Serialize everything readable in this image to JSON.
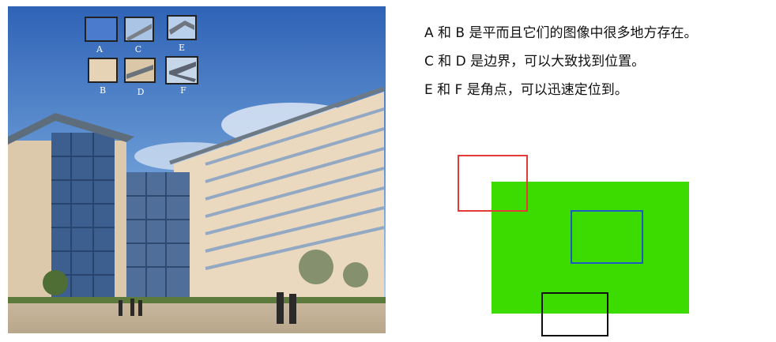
{
  "photo": {
    "patches": [
      {
        "label": "A",
        "icon": "flat-blue-sky-patch"
      },
      {
        "label": "C",
        "icon": "roof-edge-patch"
      },
      {
        "label": "E",
        "icon": "roof-corner-patch"
      },
      {
        "label": "B",
        "icon": "flat-wall-patch"
      },
      {
        "label": "D",
        "icon": "eave-edge-patch"
      },
      {
        "label": "F",
        "icon": "corner-patch"
      }
    ]
  },
  "notes": [
    "A 和 B 是平而且它们的图像中很多地方存在。",
    "C 和 D 是边界，可以大致找到位置。",
    "E 和 F 是角点，可以迅速定位到。"
  ],
  "diagram": {
    "colors": {
      "flat_region": "#3ddc00",
      "corner_box": "#e53935",
      "flat_box": "#1e5bbf",
      "edge_box": "#111111"
    }
  }
}
